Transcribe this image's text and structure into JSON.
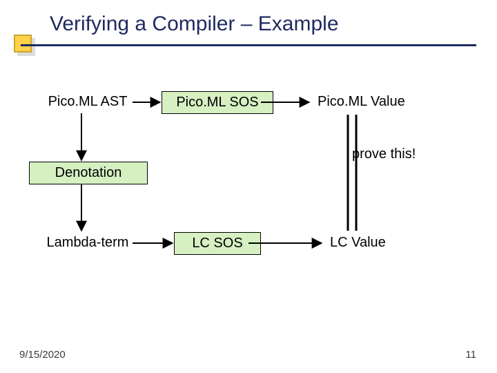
{
  "title": "Verifying a Compiler – Example",
  "nodes": {
    "picoml_ast": "Pico.ML AST",
    "picoml_sos": "Pico.ML SOS",
    "picoml_value": "Pico.ML Value",
    "denotation": "Denotation",
    "prove_this": "prove this!",
    "lambda_term": "Lambda-term",
    "lc_sos": "LC SOS",
    "lc_value": "LC Value"
  },
  "footer": {
    "date": "9/15/2020",
    "page": "11"
  },
  "chart_data": {
    "type": "diagram",
    "title": "Verifying a Compiler – Example",
    "nodes": [
      {
        "id": "picoml_ast",
        "label": "Pico.ML AST",
        "boxed": false
      },
      {
        "id": "picoml_sos",
        "label": "Pico.ML SOS",
        "boxed": true
      },
      {
        "id": "picoml_value",
        "label": "Pico.ML Value",
        "boxed": false
      },
      {
        "id": "denotation",
        "label": "Denotation",
        "boxed": true
      },
      {
        "id": "lambda_term",
        "label": "Lambda-term",
        "boxed": false
      },
      {
        "id": "lc_sos",
        "label": "LC SOS",
        "boxed": true
      },
      {
        "id": "lc_value",
        "label": "LC Value",
        "boxed": false
      }
    ],
    "edges": [
      {
        "from": "picoml_ast",
        "to": "picoml_sos",
        "style": "arrow"
      },
      {
        "from": "picoml_sos",
        "to": "picoml_value",
        "style": "arrow"
      },
      {
        "from": "picoml_ast",
        "to": "denotation",
        "style": "arrow"
      },
      {
        "from": "denotation",
        "to": "lambda_term",
        "style": "arrow"
      },
      {
        "from": "lambda_term",
        "to": "lc_sos",
        "style": "arrow"
      },
      {
        "from": "lc_sos",
        "to": "lc_value",
        "style": "arrow"
      },
      {
        "from": "picoml_value",
        "to": "lc_value",
        "style": "double-line",
        "label": "prove this!"
      }
    ]
  }
}
